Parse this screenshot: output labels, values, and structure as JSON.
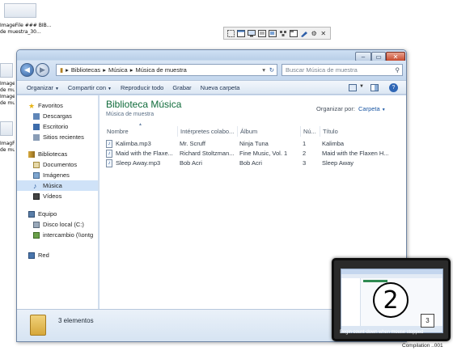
{
  "desktop": {
    "icon_top_label_1": "ImageFile ### BIB...",
    "icon_top_label_2": "de muestra_30...",
    "strip_1a": "ImageFile",
    "strip_1b": "de muest",
    "strip_2a": "Image",
    "strip_2b": "de mue",
    "strip_3a": "ImagFile",
    "strip_3b": "de muest"
  },
  "window": {
    "address": {
      "parts": [
        "Bibliotecas",
        "Música",
        "Música de muestra"
      ],
      "sep": "▸"
    },
    "search_placeholder": "Buscar Música de muestra",
    "commands": [
      "Organizar",
      "Compartir con",
      "Reproducir todo",
      "Grabar",
      "Nueva carpeta"
    ],
    "nav": {
      "favorites_header": "Favoritos",
      "favorites": [
        "Descargas",
        "Escritorio",
        "Sitios recientes"
      ],
      "libraries_header": "Bibliotecas",
      "libraries": [
        "Documentos",
        "Imágenes",
        "Música",
        "Vídeos"
      ],
      "computer_header": "Equipo",
      "computer": [
        "Disco local (C:)",
        "intercambio (\\\\ontg"
      ],
      "network": "Red"
    },
    "library": {
      "title": "Biblioteca Música",
      "subtitle": "Música de muestra",
      "arrange_label": "Organizar por:",
      "arrange_value": "Carpeta"
    },
    "columns": [
      "Nombre",
      "Intérpretes colabo...",
      "Álbum",
      "Nú...",
      "Título"
    ],
    "files": [
      {
        "name": "Kalimba.mp3",
        "artist": "Mr. Scruff",
        "album": "Ninja Tuna",
        "num": "1",
        "title": "Kalimba"
      },
      {
        "name": "Maid with the Flaxe...",
        "artist": "Richard Stoltzman...",
        "album": "Fine Music, Vol. 1",
        "num": "2",
        "title": "Maid with the Flaxen H..."
      },
      {
        "name": "Sleep Away.mp3",
        "artist": "Bob Acri",
        "album": "Bob Acri",
        "num": "3",
        "title": "Sleep Away"
      }
    ],
    "item_count": "3 elementos"
  },
  "popup": {
    "step_number": "2",
    "small_number": "3",
    "caption": "Begin count-down when mouse stopped"
  },
  "footer_text": "Compilation ..001",
  "colors": {
    "library_title": "#0f6b3a",
    "accent": "#1b57a3",
    "selection": "#cfe2f8"
  }
}
